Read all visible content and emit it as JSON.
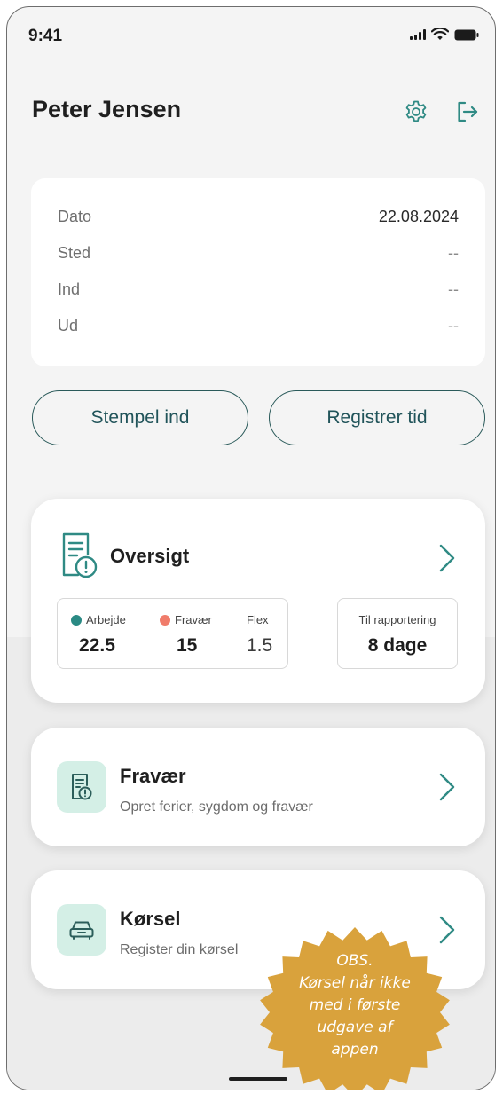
{
  "status_bar": {
    "time": "9:41"
  },
  "header": {
    "user_name": "Peter Jensen"
  },
  "info": {
    "rows": [
      {
        "label": "Dato",
        "value": "22.08.2024"
      },
      {
        "label": "Sted",
        "value": "--"
      },
      {
        "label": "Ind",
        "value": "--"
      },
      {
        "label": "Ud",
        "value": "--"
      }
    ]
  },
  "actions": {
    "clock_in_label": "Stempel ind",
    "register_time_label": "Registrer tid"
  },
  "overview": {
    "title": "Oversigt",
    "work_label": "Arbejde",
    "work_value": "22.5",
    "absence_label": "Fravær",
    "absence_value": "15",
    "flex_label": "Flex",
    "flex_value": "1.5",
    "reporting_label": "Til rapportering",
    "reporting_value": "8 dage"
  },
  "absence_card": {
    "title": "Fravær",
    "subtitle": "Opret ferier, sygdom og fravær"
  },
  "driving_card": {
    "title": "Kørsel",
    "subtitle": "Register din kørsel"
  },
  "notice_badge": {
    "lines": [
      "OBS.",
      "Kørsel når ikke",
      "med i første",
      "udgave af",
      "appen"
    ]
  },
  "colors": {
    "accent": "#2f8a84",
    "accent_dark": "#21545a",
    "work_dot": "#2a8a84",
    "absence_dot": "#f07c6b",
    "icon_tile_bg": "#d4efe6",
    "badge": "#d9a23c",
    "background": "#f4f4f4"
  },
  "icons": {
    "settings": "gear-icon",
    "logout": "logout-icon",
    "overview": "document-alert-icon",
    "absence": "document-alert-icon",
    "driving": "car-icon",
    "chevron": "chevron-right-icon"
  }
}
